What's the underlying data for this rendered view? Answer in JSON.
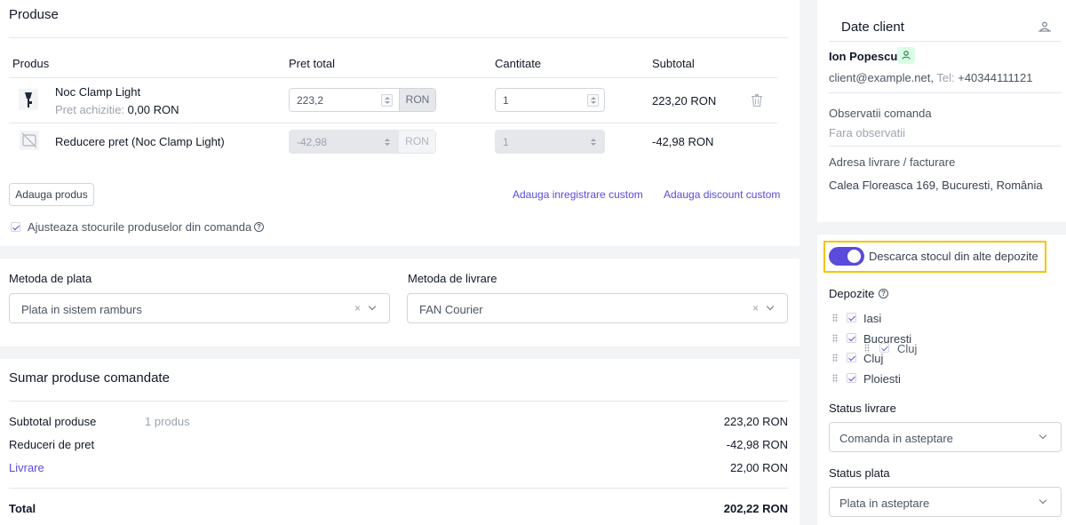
{
  "products": {
    "title": "Produse",
    "columns": {
      "product": "Produs",
      "price": "Pret total",
      "qty": "Cantitate",
      "subtotal": "Subtotal"
    },
    "rows": [
      {
        "name": "Noc Clamp Light",
        "cost_label": "Pret achizitie:",
        "cost_value": "0,00 RON",
        "price": "223,2",
        "currency": "RON",
        "qty": "1",
        "subtotal": "223,20 RON"
      },
      {
        "name": "Reducere pret (Noc Clamp Light)",
        "price": "-42,98",
        "currency": "RON",
        "qty": "1",
        "subtotal": "-42,98 RON"
      }
    ],
    "add_product": "Adauga produs",
    "add_custom_entry": "Adauga inregistrare custom",
    "add_custom_discount": "Adauga discount custom",
    "adjust_stock": "Ajusteaza stocurile produselor din comanda"
  },
  "payment": {
    "label": "Metoda de plata",
    "value": "Plata in sistem ramburs"
  },
  "shipping": {
    "label": "Metoda de livrare",
    "value": "FAN Courier"
  },
  "summary": {
    "title": "Sumar produse comandate",
    "subtotal_label": "Subtotal produse",
    "subtotal_count": "1 produs",
    "subtotal_value": "223,20 RON",
    "discounts_label": "Reduceri de pret",
    "discounts_value": "-42,98 RON",
    "delivery_label": "Livrare",
    "delivery_value": "22,00 RON",
    "total_label": "Total",
    "total_value": "202,22 RON"
  },
  "client": {
    "title": "Date client",
    "name": "Ion Popescu",
    "email": "client@example.net,",
    "phone_label": "Tel:",
    "phone": "+40344111121",
    "notes_label": "Observatii comanda",
    "notes_value": "Fara observatii",
    "address_label": "Adresa livrare / facturare",
    "address_value": "Calea Floreasca 169, Bucuresti, România"
  },
  "stock": {
    "toggle_label": "Descarca stocul din alte depozite",
    "toggle_on": true,
    "warehouses_label": "Depozite",
    "warehouses": [
      "Iasi",
      "Bucuresti",
      "Cluj",
      "Ploiesti"
    ],
    "dragging": "Cluj"
  },
  "status_delivery": {
    "label": "Status livrare",
    "value": "Comanda in asteptare"
  },
  "status_payment": {
    "label": "Status plata",
    "value": "Plata in asteptare"
  },
  "colors": {
    "accent": "#5b4bdb",
    "highlight": "#f5c400"
  }
}
